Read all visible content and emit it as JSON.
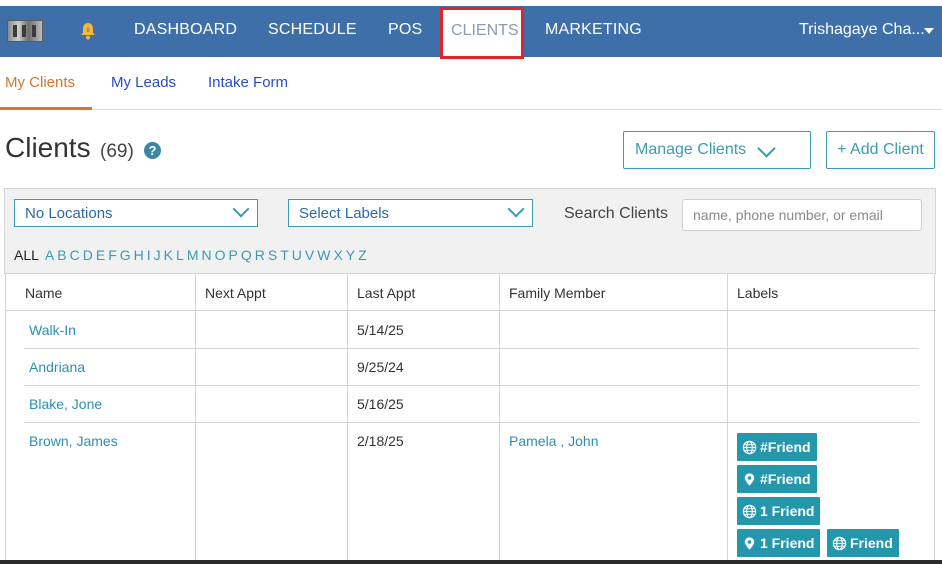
{
  "nav": {
    "items": [
      "DASHBOARD",
      "SCHEDULE",
      "POS",
      "CLIENTS",
      "MARKETING"
    ],
    "active": "CLIENTS",
    "user": "Trishagaye Cha..."
  },
  "subtabs": [
    "My Clients",
    "My Leads",
    "Intake Form"
  ],
  "heading": {
    "title": "Clients",
    "count": "(69)",
    "help": "?"
  },
  "buttons": {
    "manage": "Manage Clients",
    "add": "+ Add Client"
  },
  "filters": {
    "locations": "No Locations",
    "labels": "Select Labels",
    "search_label": "Search Clients",
    "search_placeholder": "name, phone number, or email"
  },
  "alphabet": [
    "ALL",
    "A",
    "B",
    "C",
    "D",
    "E",
    "F",
    "G",
    "H",
    "I",
    "J",
    "K",
    "L",
    "M",
    "N",
    "O",
    "P",
    "Q",
    "R",
    "S",
    "T",
    "U",
    "V",
    "W",
    "X",
    "Y",
    "Z"
  ],
  "table": {
    "columns": [
      "Name",
      "Next Appt",
      "Last Appt",
      "Family Member",
      "Labels"
    ],
    "rows": [
      {
        "name": "Walk-In",
        "next": "",
        "last": "5/14/25",
        "family": ""
      },
      {
        "name": "Andriana",
        "next": "",
        "last": "9/25/24",
        "family": ""
      },
      {
        "name": "Blake, Jone",
        "next": "",
        "last": "5/16/25",
        "family": ""
      },
      {
        "name": "Brown, James",
        "next": "",
        "last": "2/18/25",
        "family": "Pamela , John"
      }
    ],
    "labels": [
      {
        "icon": "globe-icon",
        "text": "#Friend"
      },
      {
        "icon": "location-pin-icon",
        "text": "#Friend"
      },
      {
        "icon": "globe-icon",
        "text": "1 Friend"
      },
      {
        "icon": "location-pin-icon",
        "text": "1 Friend"
      },
      {
        "icon": "globe-icon",
        "text": "Friend"
      }
    ]
  },
  "colors": {
    "nav_bg": "#3e6fa8",
    "accent": "#3b9bb0",
    "active_tab": "#d8742d",
    "highlight_border": "#e0262b",
    "badge": "#2597ad"
  }
}
